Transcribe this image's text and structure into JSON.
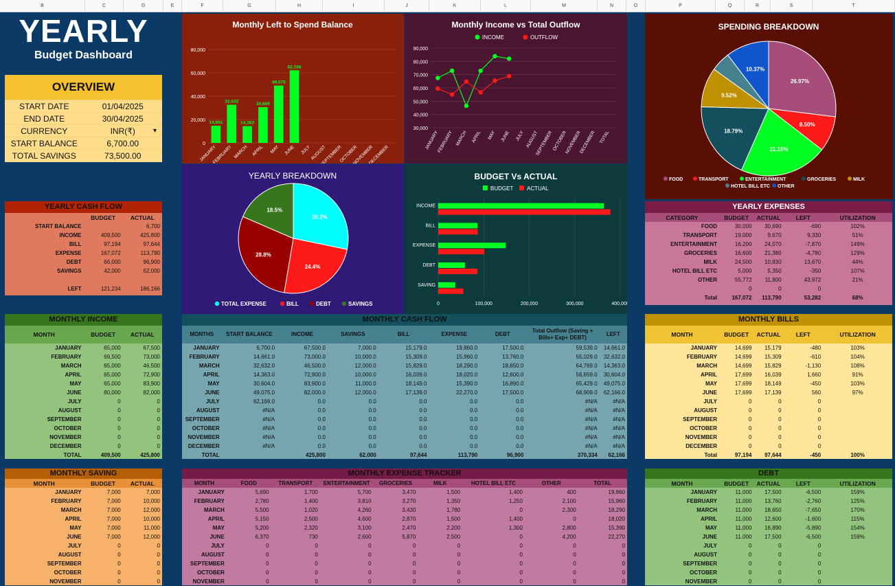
{
  "columns": [
    "B",
    "C",
    "D",
    "E",
    "F",
    "G",
    "H",
    "I",
    "J",
    "K",
    "L",
    "M",
    "N",
    "O",
    "P",
    "Q",
    "R",
    "S",
    "T"
  ],
  "title": {
    "big": "YEARLY",
    "sub": "Budget Dashboard"
  },
  "overview": {
    "title": "OVERVIEW",
    "rows": [
      {
        "label": "START DATE",
        "value": "01/04/2025"
      },
      {
        "label": "END DATE",
        "value": "30/04/2025"
      },
      {
        "label": "CURRENCY",
        "value": "INR(₹)"
      },
      {
        "label": "START BALANCE",
        "value": "6,700.00"
      },
      {
        "label": "TOTAL SAVINGS",
        "value": "73,500.00"
      }
    ]
  },
  "yearly_cash_flow": {
    "title": "YEARLY CASH FLOW",
    "headers": [
      "",
      "BUDGET",
      "ACTUAL"
    ],
    "rows": [
      [
        "START BALANCE",
        "",
        "6,700"
      ],
      [
        "INCOME",
        "409,500",
        "425,800"
      ],
      [
        "BILL",
        "97,194",
        "97,644"
      ],
      [
        "EXPENSE",
        "167,072",
        "113,790"
      ],
      [
        "DEBT",
        "66,000",
        "96,900"
      ],
      [
        "SAVINGS",
        "42,000",
        "62,000"
      ],
      [
        "",
        "",
        ""
      ],
      [
        "LEFT",
        "121,234",
        "186,166"
      ]
    ]
  },
  "monthly_income": {
    "title": "MONTHLY INCOME",
    "headers": [
      "MONTH",
      "BUDGET",
      "ACTUAL"
    ],
    "rows": [
      [
        "JANUARY",
        "65,000",
        "67,500"
      ],
      [
        "FEBRUARY",
        "69,500",
        "73,000"
      ],
      [
        "MARCH",
        "65,000",
        "46,500"
      ],
      [
        "APRIL",
        "65,000",
        "72,900"
      ],
      [
        "MAY",
        "65,000",
        "83,900"
      ],
      [
        "JUNE",
        "80,000",
        "82,000"
      ],
      [
        "JULY",
        "0",
        "0"
      ],
      [
        "AUGUST",
        "0",
        "0"
      ],
      [
        "SEPTEMBER",
        "0",
        "0"
      ],
      [
        "OCTOBER",
        "0",
        "0"
      ],
      [
        "NOVEMBER",
        "0",
        "0"
      ],
      [
        "DECEMBER",
        "0",
        "0"
      ],
      [
        "TOTAL",
        "409,500",
        "425,800"
      ]
    ]
  },
  "monthly_saving": {
    "title": "MONTHLY SAVING",
    "headers": [
      "MONTH",
      "BUDGET",
      "ACTUAL"
    ],
    "rows": [
      [
        "JANUARY",
        "7,000",
        "7,000"
      ],
      [
        "FEBRUARY",
        "7,000",
        "10,000"
      ],
      [
        "MARCH",
        "7,000",
        "12,000"
      ],
      [
        "APRIL",
        "7,000",
        "10,000"
      ],
      [
        "MAY",
        "7,000",
        "11,000"
      ],
      [
        "JUNE",
        "7,000",
        "12,000"
      ],
      [
        "JULY",
        "0",
        "0"
      ],
      [
        "AUGUST",
        "0",
        "0"
      ],
      [
        "SEPTEMBER",
        "0",
        "0"
      ],
      [
        "OCTOBER",
        "0",
        "0"
      ],
      [
        "NOVEMBER",
        "0",
        "0"
      ]
    ]
  },
  "monthly_cash_flow": {
    "title": "MONTHLY CASH FLOW",
    "headers": [
      "MONTHS",
      "START BALANCE",
      "INCOME",
      "SAVINGS",
      "BILL",
      "EXPENSE",
      "DEBT",
      "Total Outflow (Saving + Bills+ Exp+ DEBT)",
      "LEFT"
    ],
    "rows": [
      [
        "JANUARY",
        "6,700.0",
        "67,500.0",
        "7,000.0",
        "15,179.0",
        "19,860.0",
        "17,500.0",
        "59,539.0",
        "14,661.0"
      ],
      [
        "FEBRUARY",
        "14,661.0",
        "73,000.0",
        "10,000.0",
        "15,309.0",
        "15,960.0",
        "13,760.0",
        "55,029.0",
        "32,632.0"
      ],
      [
        "MARCH",
        "32,632.0",
        "46,500.0",
        "12,000.0",
        "15,829.0",
        "18,290.0",
        "18,650.0",
        "64,769.0",
        "14,363.0"
      ],
      [
        "APRIL",
        "14,363.0",
        "72,900.0",
        "10,000.0",
        "16,039.0",
        "18,020.0",
        "12,600.0",
        "56,659.0",
        "30,604.0"
      ],
      [
        "MAY",
        "30,604.0",
        "83,900.0",
        "11,000.0",
        "18,149.0",
        "15,390.0",
        "16,890.0",
        "65,429.0",
        "49,075.0"
      ],
      [
        "JUNE",
        "49,075.0",
        "82,000.0",
        "12,000.0",
        "17,139.0",
        "22,270.0",
        "17,500.0",
        "68,909.0",
        "62,166.0"
      ],
      [
        "JULY",
        "62,166.0",
        "0.0",
        "0.0",
        "0.0",
        "0.0",
        "0.0",
        "#N/A",
        "#N/A"
      ],
      [
        "AUGUST",
        "#N/A",
        "0.0",
        "0.0",
        "0.0",
        "0.0",
        "0.0",
        "#N/A",
        "#N/A"
      ],
      [
        "SEPTEMBER",
        "#N/A",
        "0.0",
        "0.0",
        "0.0",
        "0.0",
        "0.0",
        "#N/A",
        "#N/A"
      ],
      [
        "OCTOBER",
        "#N/A",
        "0.0",
        "0.0",
        "0.0",
        "0.0",
        "0.0",
        "#N/A",
        "#N/A"
      ],
      [
        "NOVEMBER",
        "#N/A",
        "0.0",
        "0.0",
        "0.0",
        "0.0",
        "0.0",
        "#N/A",
        "#N/A"
      ],
      [
        "DECEMBER",
        "#N/A",
        "0.0",
        "0.0",
        "0.0",
        "0.0",
        "0.0",
        "#N/A",
        "#N/A"
      ],
      [
        "TOTAL",
        "",
        "425,800",
        "62,000",
        "97,644",
        "113,790",
        "96,900",
        "370,334",
        "62,166"
      ]
    ]
  },
  "monthly_expense": {
    "title": "MONTHLY EXPENSE TRACKER",
    "headers": [
      "MONTH",
      "FOOD",
      "TRANSPORT",
      "ENTERTAINMENT",
      "GROCERIES",
      "MILK",
      "HOTEL BILL ETC",
      "OTHER",
      "TOTAL"
    ],
    "rows": [
      [
        "JANUARY",
        "5,690",
        "1,700",
        "5,700",
        "3,470",
        "1,500",
        "1,400",
        "400",
        "19,860"
      ],
      [
        "FEBRUARY",
        "2,780",
        "1,400",
        "3,810",
        "3,270",
        "1,350",
        "1,250",
        "2,100",
        "15,960"
      ],
      [
        "MARCH",
        "5,500",
        "1,020",
        "4,260",
        "3,430",
        "1,780",
        "0",
        "2,300",
        "18,290"
      ],
      [
        "APRIL",
        "5,150",
        "2,500",
        "4,600",
        "2,870",
        "1,500",
        "1,400",
        "0",
        "18,020"
      ],
      [
        "MAY",
        "5,200",
        "2,320",
        "3,100",
        "2,470",
        "2,200",
        "1,300",
        "2,800",
        "15,390"
      ],
      [
        "JUNE",
        "6,370",
        "730",
        "2,600",
        "5,870",
        "2,500",
        "0",
        "4,200",
        "22,270"
      ],
      [
        "JULY",
        "0",
        "0",
        "0",
        "0",
        "0",
        "0",
        "0",
        "0"
      ],
      [
        "AUGUST",
        "0",
        "0",
        "0",
        "0",
        "0",
        "0",
        "0",
        "0"
      ],
      [
        "SEPTEMBER",
        "0",
        "0",
        "0",
        "0",
        "0",
        "0",
        "0",
        "0"
      ],
      [
        "OCTOBER",
        "0",
        "0",
        "0",
        "0",
        "0",
        "0",
        "0",
        "0"
      ],
      [
        "NOVEMBER",
        "0",
        "0",
        "0",
        "0",
        "0",
        "0",
        "0",
        "0"
      ]
    ]
  },
  "yearly_expenses": {
    "title": "YEARLY EXPENSES",
    "headers": [
      "CATEGORY",
      "BUDGET",
      "ACTUAL",
      "LEFT",
      "UTILIZATION"
    ],
    "rows": [
      [
        "FOOD",
        "30,000",
        "30,690",
        "-690",
        "102%"
      ],
      [
        "TRANSPORT",
        "19,000",
        "9,670",
        "9,330",
        "51%"
      ],
      [
        "ENTERTAINMENT",
        "16,200",
        "24,070",
        "-7,870",
        "149%"
      ],
      [
        "GROCERIES",
        "16,600",
        "21,380",
        "-4,780",
        "129%"
      ],
      [
        "MILK",
        "24,500",
        "10,830",
        "13,670",
        "44%"
      ],
      [
        "HOTEL BILL ETC",
        "5,000",
        "5,350",
        "-350",
        "107%"
      ],
      [
        "OTHER",
        "55,772",
        "11,800",
        "43,972",
        "21%"
      ],
      [
        "",
        "0",
        "0",
        "0",
        ""
      ],
      [
        "Total",
        "167,072",
        "113,790",
        "53,282",
        "68%"
      ]
    ]
  },
  "monthly_bills": {
    "title": "MONTHLY BILLS",
    "headers": [
      "MONTH",
      "BUDGET",
      "ACTUAL",
      "LEFT",
      "UTILIZATION"
    ],
    "rows": [
      [
        "JANUARY",
        "14,699",
        "15,179",
        "-480",
        "103%"
      ],
      [
        "FEBRUARY",
        "14,699",
        "15,309",
        "-610",
        "104%"
      ],
      [
        "MARCH",
        "14,699",
        "15,829",
        "-1,130",
        "108%"
      ],
      [
        "APRIL",
        "17,699",
        "16,039",
        "1,660",
        "91%"
      ],
      [
        "MAY",
        "17,699",
        "18,149",
        "-450",
        "103%"
      ],
      [
        "JUNE",
        "17,699",
        "17,139",
        "560",
        "97%"
      ],
      [
        "JULY",
        "0",
        "0",
        "0",
        ""
      ],
      [
        "AUGUST",
        "0",
        "0",
        "0",
        ""
      ],
      [
        "SEPTEMBER",
        "0",
        "0",
        "0",
        ""
      ],
      [
        "OCTOBER",
        "0",
        "0",
        "0",
        ""
      ],
      [
        "NOVEMBER",
        "0",
        "0",
        "0",
        ""
      ],
      [
        "DECEMBER",
        "0",
        "0",
        "0",
        ""
      ],
      [
        "Total",
        "97,194",
        "97,644",
        "-450",
        "100%"
      ]
    ]
  },
  "debt": {
    "title": "DEBT",
    "headers": [
      "MONTH",
      "BUDGET",
      "ACTUAL",
      "LEFT",
      "UTILIZATION"
    ],
    "rows": [
      [
        "JANUARY",
        "11,000",
        "17,500",
        "-6,500",
        "159%"
      ],
      [
        "FEBRUARY",
        "11,000",
        "13,760",
        "-2,760",
        "125%"
      ],
      [
        "MARCH",
        "11,000",
        "18,650",
        "-7,650",
        "170%"
      ],
      [
        "APRIL",
        "11,000",
        "12,600",
        "-1,600",
        "115%"
      ],
      [
        "MAY",
        "11,000",
        "16,890",
        "-5,890",
        "154%"
      ],
      [
        "JUNE",
        "11,000",
        "17,500",
        "-6,500",
        "159%"
      ],
      [
        "JULY",
        "0",
        "0",
        "0",
        ""
      ],
      [
        "AUGUST",
        "0",
        "0",
        "0",
        ""
      ],
      [
        "SEPTEMBER",
        "0",
        "0",
        "0",
        ""
      ],
      [
        "OCTOBER",
        "0",
        "0",
        "0",
        ""
      ],
      [
        "NOVEMBER",
        "0",
        "0",
        "0",
        ""
      ]
    ]
  },
  "colors": {
    "bg": "#0b3a66",
    "green": "#00ff22",
    "red": "#ff1a1a"
  },
  "chart_data": [
    {
      "type": "bar",
      "title": "Monthly Left to Spend Balance",
      "categories": [
        "JANUARY",
        "FEBRUARY",
        "MARCH",
        "APRIL",
        "MAY",
        "JUNE",
        "JULY",
        "AUGUST",
        "SEPTEMBER",
        "OCTOBER",
        "NOVEMBER",
        "DECEMBER"
      ],
      "values": [
        14661,
        32632,
        14363,
        30604,
        49075,
        62166,
        0,
        0,
        0,
        0,
        0,
        0
      ],
      "value_labels": [
        "14,661",
        "32,632",
        "14,363",
        "30,604",
        "49,075",
        "62,166"
      ],
      "ylim": [
        0,
        80000
      ],
      "yticks": [
        "0",
        "20,000",
        "40,000",
        "60,000",
        "80,000"
      ]
    },
    {
      "type": "line",
      "title": "Monthly Income vs Total Outflow",
      "categories": [
        "JANUARY",
        "FEBRUARY",
        "MARCH",
        "APRIL",
        "MAY",
        "JUNE",
        "JULY",
        "AUGUST",
        "SEPTEMBER",
        "OCTOBER",
        "NOVEMBER",
        "DECEMBER",
        "TOTAL"
      ],
      "series": [
        {
          "name": "INCOME",
          "values": [
            67500,
            73000,
            46500,
            72900,
            83900,
            82000
          ]
        },
        {
          "name": "OUTFLOW",
          "values": [
            59539,
            55029,
            64769,
            56659,
            65429,
            68909
          ]
        }
      ],
      "ylim": [
        30000,
        90000
      ],
      "yticks": [
        "30,000",
        "40,000",
        "50,000",
        "60,000",
        "70,000",
        "80,000",
        "90,000"
      ]
    },
    {
      "type": "pie",
      "title": "SPENDING BREAKDOWN",
      "labels": [
        "FOOD",
        "TRANSPORT",
        "ENTERTAINMENT",
        "GROCERIES",
        "MILK",
        "HOTEL BILL ETC",
        "OTHER"
      ],
      "values": [
        26.97,
        8.5,
        21.15,
        18.79,
        9.52,
        4.7,
        10.37
      ],
      "value_labels": [
        "26.97%",
        "8.50%",
        "21.15%",
        "18.79%",
        "9.52%",
        "",
        "10.37%"
      ]
    },
    {
      "type": "pie",
      "title": "YEARLY BREAKDOWN",
      "labels": [
        "TOTAL EXPENSE",
        "BILL",
        "DEBT",
        "SAVINGS"
      ],
      "values": [
        28.2,
        24.4,
        28.8,
        18.5
      ],
      "value_labels": [
        "28.2%",
        "24.4%",
        "28.8%",
        "18.5%"
      ]
    },
    {
      "type": "bar",
      "title": "BUDGET  Vs ACTUAL",
      "categories": [
        "INCOME",
        "BILL",
        "EXPENSE",
        "DEBT",
        "SAVING"
      ],
      "series": [
        {
          "name": "BUDGET",
          "values": [
            409500,
            97194,
            167072,
            66000,
            42000
          ]
        },
        {
          "name": "ACTUAL",
          "values": [
            425800,
            97644,
            113790,
            96900,
            62000
          ]
        }
      ],
      "xlim": [
        0,
        450000
      ],
      "xticks": [
        "0",
        "100,000",
        "200,000",
        "300,000",
        "400,000"
      ]
    }
  ]
}
